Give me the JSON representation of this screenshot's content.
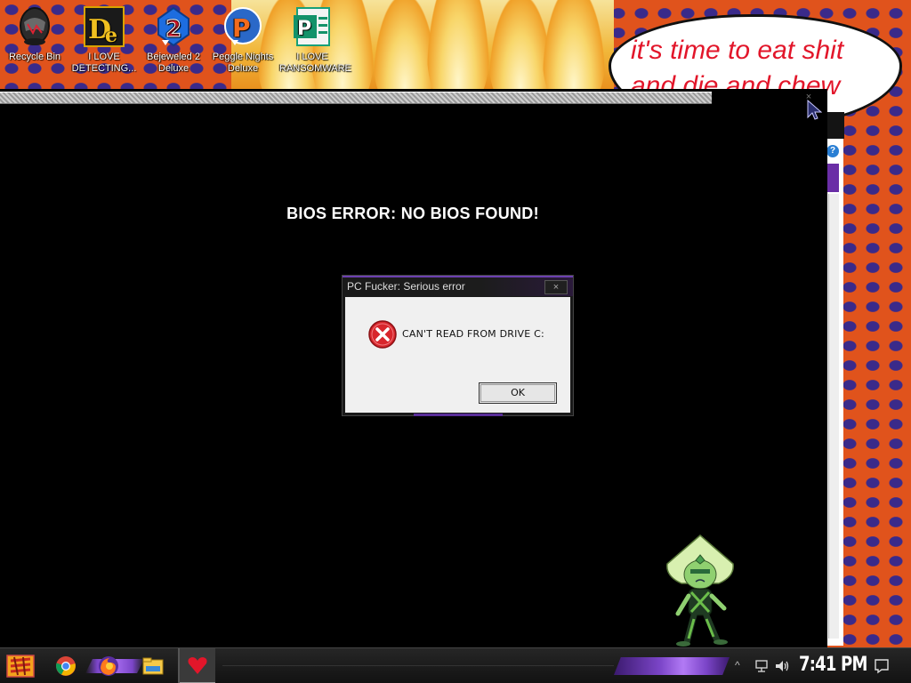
{
  "wallpaper": {
    "speech_bubble_lines": [
      "it's time to eat shit",
      "and die and chew"
    ]
  },
  "desktop_icons": [
    {
      "label": "Recycle Bin",
      "icon": "recycle-bin-icon"
    },
    {
      "label": "I LOVE DETECTING...",
      "icon": "detective-icon"
    },
    {
      "label": "Bejeweled 2 Deluxe",
      "icon": "bejeweled-icon"
    },
    {
      "label": "Peggle Nights Deluxe",
      "icon": "peggle-icon"
    },
    {
      "label": "I LOVE RANSOMWARE",
      "icon": "ransomware-icon"
    }
  ],
  "main_window": {
    "message": "BIOS ERROR: NO BIOS FOUND!",
    "close_glyph": "×"
  },
  "dialog": {
    "title": "PC Fucker: Serious error",
    "message": "CAN'T READ FROM DRIVE C:",
    "ok_label": "OK",
    "close_glyph": "×",
    "icon": "error-icon"
  },
  "background_window": {
    "help_glyph": "?"
  },
  "taskbar": {
    "start_icon": "start-icon",
    "pinned": [
      "chrome-icon",
      "firefox-icon",
      "file-explorer-icon"
    ],
    "active_app_icon": "heart-icon",
    "tray_chevron": "^",
    "clock": "7:41 PM"
  },
  "colors": {
    "accent": "#7b45c8",
    "wallpaper": "#e0531c",
    "speech_text": "#e2162a"
  }
}
